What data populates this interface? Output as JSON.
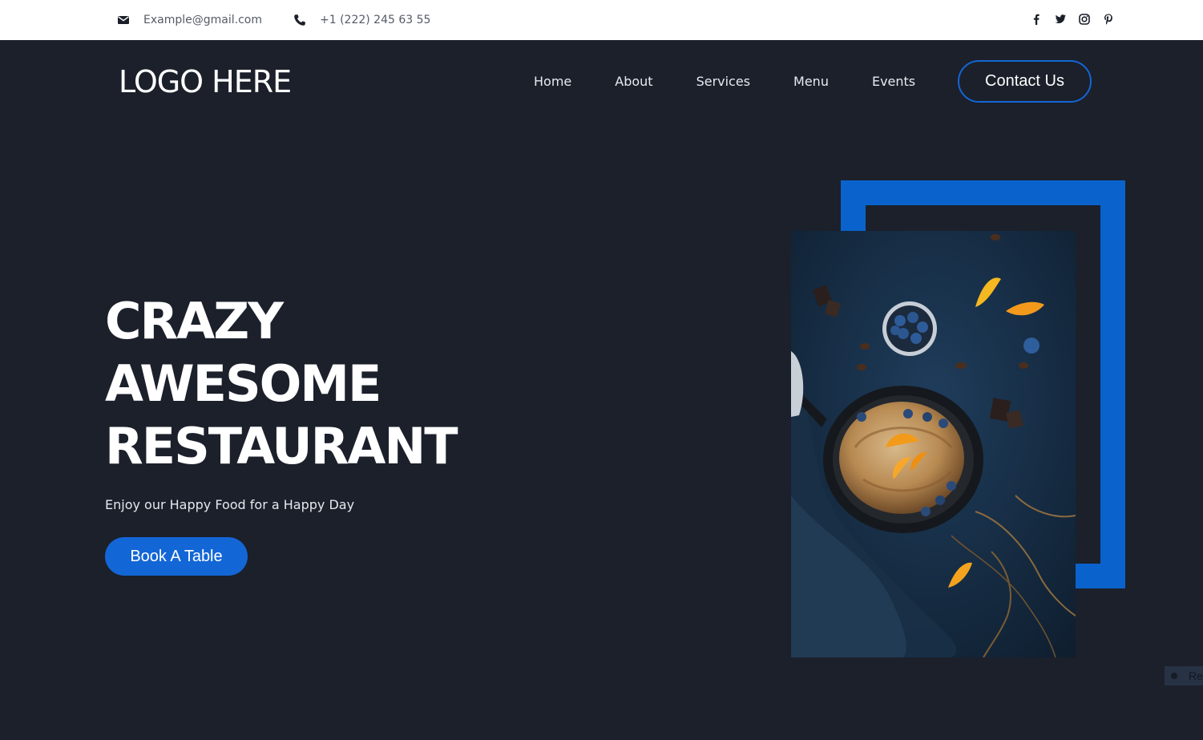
{
  "topbar": {
    "email": "Example@gmail.com",
    "phone": "+1 (222) 245 63 55",
    "socials": [
      "facebook-icon",
      "twitter-icon",
      "instagram-icon",
      "pinterest-icon"
    ]
  },
  "header": {
    "logo": "LOGO HERE",
    "nav": [
      "Home",
      "About",
      "Services",
      "Menu",
      "Events"
    ],
    "contact_label": "Contact Us"
  },
  "hero": {
    "title_lines": [
      "CRAZY",
      "AWESOME",
      "RESTAURANT"
    ],
    "subtitle": "Enjoy our Happy Food for a Happy Day",
    "cta_label": "Book A Table"
  },
  "corner_widget": {
    "label": "Re"
  },
  "colors": {
    "background": "#1b202b",
    "accent": "#1366d6",
    "frame": "#0a63cc",
    "topbar": "#ffffff"
  }
}
